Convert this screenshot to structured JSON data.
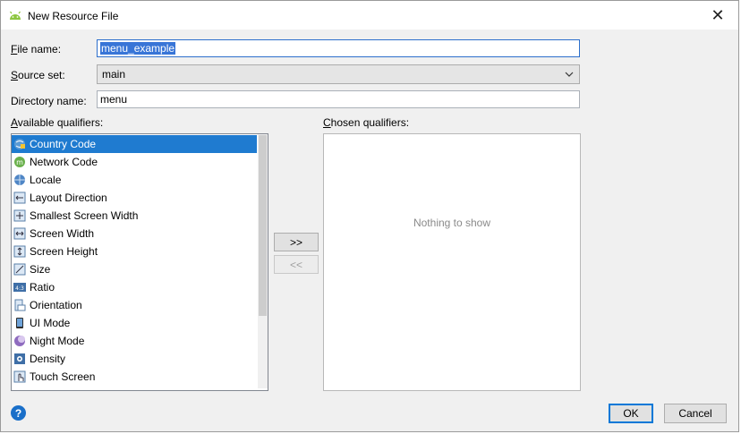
{
  "window": {
    "title": "New Resource File",
    "close_glyph": "✕"
  },
  "form": {
    "file_name_label_access": "F",
    "file_name_label_rest": "ile name:",
    "file_name_value": "menu_example",
    "source_set_label_access": "S",
    "source_set_label_rest": "ource set:",
    "source_set_value": "main",
    "directory_name_label": "Directory name:",
    "directory_name_value": "menu"
  },
  "qualifiers": {
    "available_label_pre": "",
    "available_label_access": "A",
    "available_label_rest": "vailable qualifiers:",
    "chosen_label_pre": "C",
    "chosen_label_rest": "hosen qualifiers:",
    "available": [
      {
        "label": "Country Code",
        "icon": "globe-flag-icon",
        "selected": true
      },
      {
        "label": "Network Code",
        "icon": "network-icon"
      },
      {
        "label": "Locale",
        "icon": "globe-icon"
      },
      {
        "label": "Layout Direction",
        "icon": "layout-direction-icon"
      },
      {
        "label": "Smallest Screen Width",
        "icon": "smallest-width-icon"
      },
      {
        "label": "Screen Width",
        "icon": "screen-width-icon"
      },
      {
        "label": "Screen Height",
        "icon": "screen-height-icon"
      },
      {
        "label": "Size",
        "icon": "size-icon"
      },
      {
        "label": "Ratio",
        "icon": "ratio-icon"
      },
      {
        "label": "Orientation",
        "icon": "orientation-icon"
      },
      {
        "label": "UI Mode",
        "icon": "ui-mode-icon"
      },
      {
        "label": "Night Mode",
        "icon": "night-mode-icon"
      },
      {
        "label": "Density",
        "icon": "density-icon"
      },
      {
        "label": "Touch Screen",
        "icon": "touch-screen-icon"
      }
    ],
    "ratio_icon_text": "4:3",
    "chosen_empty": "Nothing to show",
    "add_button": ">>",
    "remove_button": "<<"
  },
  "buttons": {
    "ok": "OK",
    "cancel": "Cancel",
    "help": "?"
  },
  "colors": {
    "selection": "#1f7bd0",
    "focus_border": "#2d6fcc",
    "help": "#1a6fc9"
  }
}
